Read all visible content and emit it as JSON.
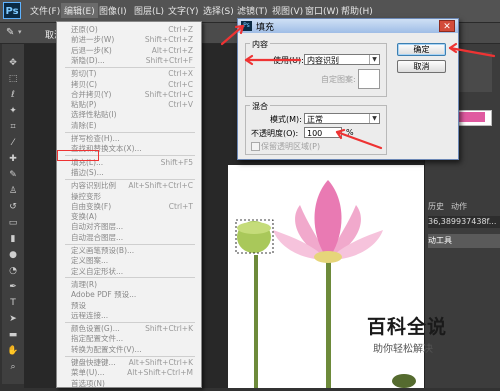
{
  "app": {
    "logo": "Ps",
    "accent": "#1e9dff"
  },
  "menubar": {
    "items": [
      "文件(F)",
      "编辑(E)",
      "图像(I)",
      "图层(L)",
      "文字(Y)",
      "选择(S)",
      "滤镜(T)",
      "视图(V)",
      "窗口(W)",
      "帮助(H)"
    ]
  },
  "options_bar": {
    "label": "取消"
  },
  "edit_menu": {
    "items": [
      {
        "label": "还原(O)",
        "shortcut": "Ctrl+Z"
      },
      {
        "label": "前进一步(W)",
        "shortcut": "Shift+Ctrl+Z"
      },
      {
        "label": "后退一步(K)",
        "shortcut": "Alt+Ctrl+Z"
      },
      {
        "label": "渐隐(D)...",
        "shortcut": "Shift+Ctrl+F"
      },
      {
        "label": "剪切(T)",
        "shortcut": "Ctrl+X"
      },
      {
        "label": "拷贝(C)",
        "shortcut": "Ctrl+C"
      },
      {
        "label": "合并拷贝(Y)",
        "shortcut": "Shift+Ctrl+C"
      },
      {
        "label": "粘贴(P)",
        "shortcut": "Ctrl+V"
      },
      {
        "label": "选择性粘贴(I)",
        "shortcut": ""
      },
      {
        "label": "清除(E)",
        "shortcut": ""
      },
      {
        "label": "拼写检查(H)...",
        "shortcut": ""
      },
      {
        "label": "查找和替换文本(X)...",
        "shortcut": ""
      },
      {
        "label": "填充(L)...",
        "shortcut": "Shift+F5"
      },
      {
        "label": "描边(S)...",
        "shortcut": ""
      },
      {
        "label": "内容识别比例",
        "shortcut": "Alt+Shift+Ctrl+C"
      },
      {
        "label": "操控变形",
        "shortcut": ""
      },
      {
        "label": "自由变换(F)",
        "shortcut": "Ctrl+T"
      },
      {
        "label": "变换(A)",
        "shortcut": ""
      },
      {
        "label": "自动对齐图层...",
        "shortcut": ""
      },
      {
        "label": "自动混合图层...",
        "shortcut": ""
      },
      {
        "label": "定义画笔预设(B)...",
        "shortcut": ""
      },
      {
        "label": "定义图案...",
        "shortcut": ""
      },
      {
        "label": "定义自定形状...",
        "shortcut": ""
      },
      {
        "label": "清理(R)",
        "shortcut": ""
      },
      {
        "label": "Adobe PDF 预设...",
        "shortcut": ""
      },
      {
        "label": "预设",
        "shortcut": ""
      },
      {
        "label": "远程连接...",
        "shortcut": ""
      },
      {
        "label": "颜色设置(G)...",
        "shortcut": "Shift+Ctrl+K"
      },
      {
        "label": "指定配置文件...",
        "shortcut": ""
      },
      {
        "label": "转换为配置文件(V)...",
        "shortcut": ""
      },
      {
        "label": "键盘快捷键...",
        "shortcut": "Alt+Shift+Ctrl+K"
      },
      {
        "label": "菜单(U)...",
        "shortcut": "Alt+Shift+Ctrl+M"
      },
      {
        "label": "首选项(N)",
        "shortcut": ""
      }
    ]
  },
  "dialog": {
    "title": "填充",
    "content_group": "内容",
    "use_label": "使用(U):",
    "use_value": "内容识别",
    "custom_pattern_label": "自定图案:",
    "blend_group": "混合",
    "mode_label": "模式(M):",
    "mode_value": "正常",
    "opacity_label": "不透明度(O):",
    "opacity_value": "100",
    "opacity_unit": "%",
    "preserve_label": "保留透明区域(P)",
    "ok": "确定",
    "cancel": "取消"
  },
  "right_panel": {
    "tab_history": "历史",
    "tab_actions": "动作",
    "coord_text": "36,389937438f...",
    "tool_row": "动工具"
  },
  "watermark": {
    "title": "百科全说",
    "subtitle": "助你轻松解决"
  },
  "colors": {
    "highlight": "#ee3333",
    "arrow": "#ee3333"
  }
}
